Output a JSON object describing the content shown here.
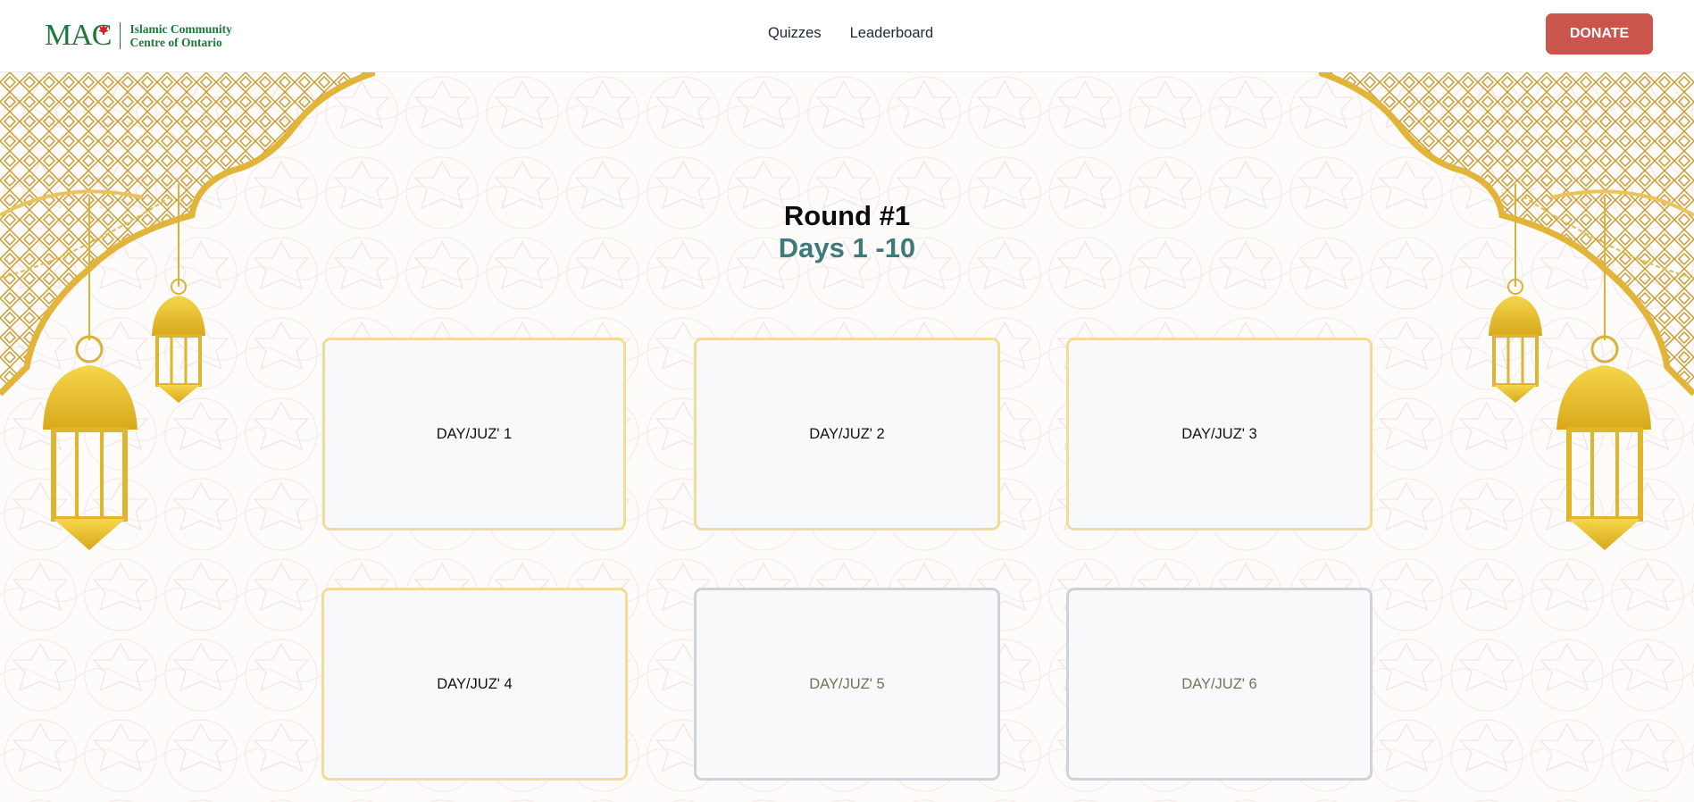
{
  "header": {
    "logo": {
      "mark": "MAC",
      "line1": "Islamic Community",
      "line2": "Centre of Ontario"
    },
    "nav": [
      {
        "label": "Quizzes"
      },
      {
        "label": "Leaderboard"
      }
    ],
    "donate_label": "DONATE"
  },
  "round": {
    "title": "Round #1",
    "subtitle": "Days 1 -10"
  },
  "cards": [
    {
      "label": "DAY/JUZ' 1",
      "state": "available"
    },
    {
      "label": "DAY/JUZ' 2",
      "state": "available"
    },
    {
      "label": "DAY/JUZ' 3",
      "state": "available"
    },
    {
      "label": "DAY/JUZ' 4",
      "state": "available"
    },
    {
      "label": "DAY/JUZ' 5",
      "state": "locked"
    },
    {
      "label": "DAY/JUZ' 6",
      "state": "locked"
    }
  ],
  "colors": {
    "brand_green": "#1a7a3a",
    "donate_red": "#c9554c",
    "subtitle_teal": "#3e7a7a",
    "gold": "#e8c43a",
    "card_border_available": "#f3dc96",
    "card_border_locked": "#cfd2d8"
  }
}
